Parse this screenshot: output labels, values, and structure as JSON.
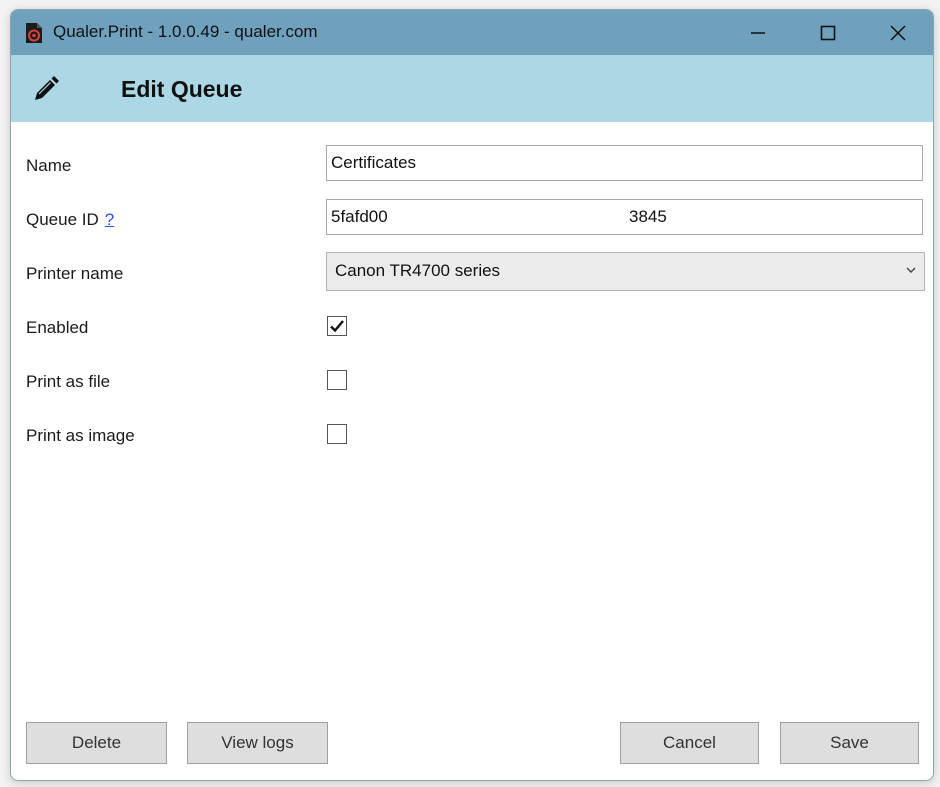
{
  "window": {
    "title": "Qualer.Print - 1.0.0.49 - qualer.com",
    "minimize_icon": "minimize-icon",
    "maximize_icon": "maximize-icon",
    "close_icon": "close-icon"
  },
  "header": {
    "icon": "pencil-icon",
    "title": "Edit Queue"
  },
  "form": {
    "name": {
      "label": "Name",
      "value": "Certificates"
    },
    "queue_id": {
      "label": "Queue ID",
      "help": "?",
      "value": "5fafd00",
      "value_end": "3845"
    },
    "printer": {
      "label": "Printer name",
      "value": "Canon TR4700 series"
    },
    "enabled": {
      "label": "Enabled",
      "checked": true
    },
    "print_as_file": {
      "label": "Print as file",
      "checked": false
    },
    "print_as_image": {
      "label": "Print as image",
      "checked": false
    }
  },
  "buttons": {
    "delete": "Delete",
    "view_logs": "View logs",
    "cancel": "Cancel",
    "save": "Save"
  },
  "colors": {
    "titlebar": "#6fa1bd",
    "header_band": "#acd8e6",
    "button_bg": "#dedede",
    "link": "#2a52d6"
  }
}
